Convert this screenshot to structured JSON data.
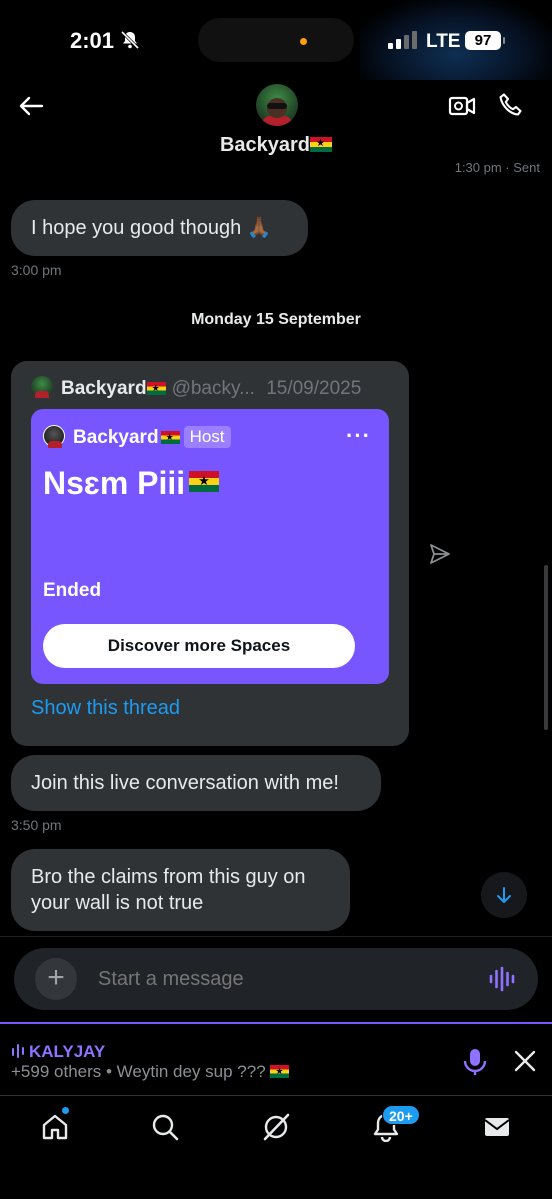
{
  "status_bar": {
    "time": "2:01",
    "network": "LTE",
    "battery": "97"
  },
  "header": {
    "contact_name": "Backyard",
    "clipped_status": "1:30 pm · Sent"
  },
  "messages": [
    {
      "text": "I hope you good though 🙏🏾",
      "time": "3:00 pm"
    },
    {
      "text": "Join this live conversation with me!",
      "time": "3:50 pm"
    },
    {
      "text": "Bro the claims from this guy on your wall is not true"
    }
  ],
  "date_separator": "Monday 15 September",
  "shared_post": {
    "author": "Backyard",
    "handle": "@backy...",
    "date": "15/09/2025",
    "space": {
      "host_name": "Backyard",
      "host_label": "Host",
      "title": "Nsɛm Piii",
      "status": "Ended",
      "button": "Discover more Spaces",
      "color": "#7856ff"
    },
    "show_thread": "Show this thread"
  },
  "composer": {
    "placeholder": "Start a message"
  },
  "live_space": {
    "host": "KALYJAY",
    "subtitle": "+599 others • Weytin dey sup ??? "
  },
  "nav": {
    "items": [
      "home-icon",
      "search-icon",
      "grok-icon",
      "notifications-icon",
      "messages-icon"
    ],
    "notification_count": "20+"
  },
  "colors": {
    "accent": "#1d9bf0",
    "space_purple": "#7856ff",
    "bubble": "#2f3336"
  }
}
